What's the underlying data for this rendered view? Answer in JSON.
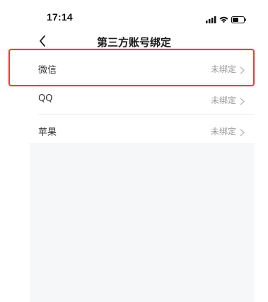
{
  "status_bar": {
    "time": "17:14",
    "icons": [
      "signal-icon",
      "wifi-icon",
      "battery-icon"
    ]
  },
  "nav": {
    "title": "第三方账号绑定",
    "back_icon": "chevron-left-icon"
  },
  "accounts": [
    {
      "label": "微信",
      "status": "未绑定"
    },
    {
      "label": "QQ",
      "status": "未绑定"
    },
    {
      "label": "苹果",
      "status": "未绑定"
    }
  ],
  "colors": {
    "highlight": "#e0453b",
    "status_text": "#9a9a9a",
    "content_bg": "#f6f7f9"
  }
}
